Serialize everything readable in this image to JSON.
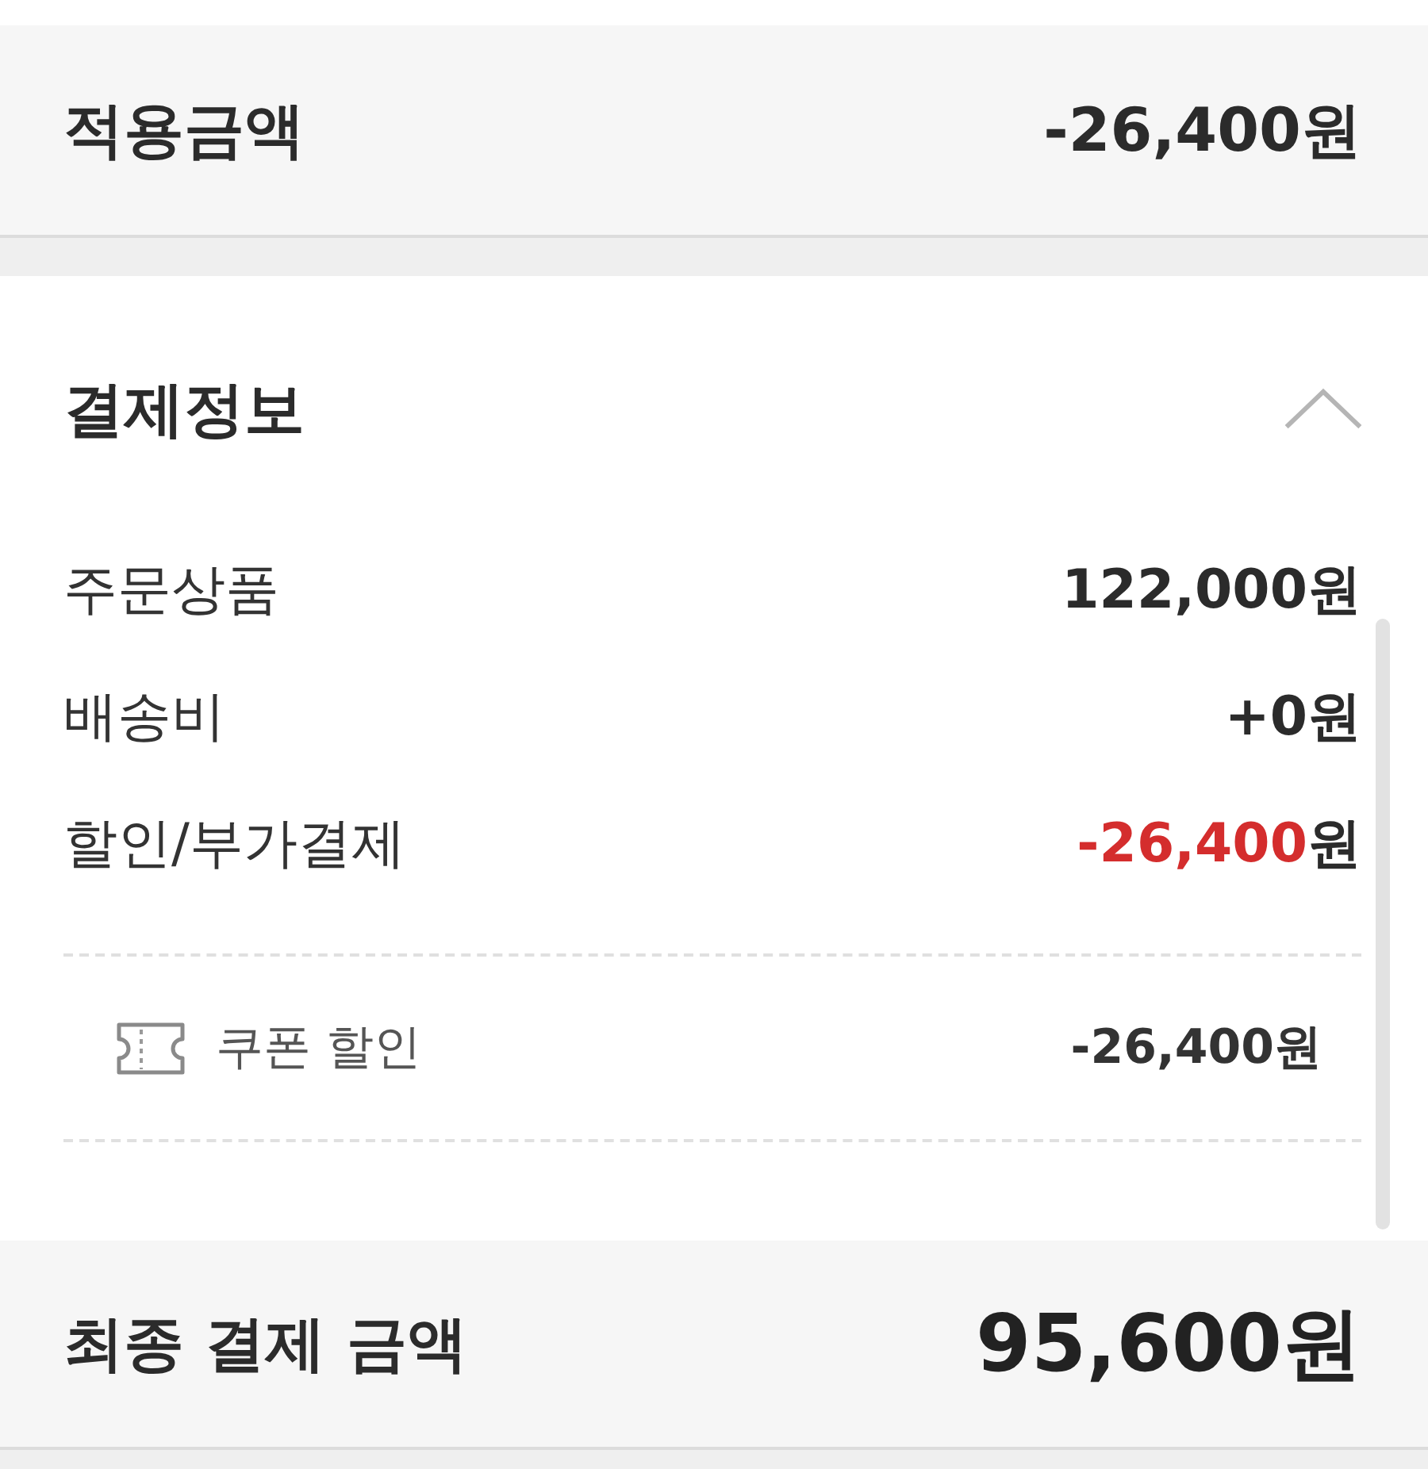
{
  "applied_amount": {
    "label": "적용금액",
    "value": "-26,400원"
  },
  "payment_info": {
    "title": "결제정보",
    "expanded": true,
    "rows": [
      {
        "label": "주문상품",
        "amount": "122,000",
        "unit": "원",
        "highlight": false
      },
      {
        "label": "배송비",
        "amount": "+0",
        "unit": "원",
        "highlight": false
      },
      {
        "label": "할인/부가결제",
        "amount": "-26,400",
        "unit": "원",
        "highlight": true
      }
    ],
    "details": [
      {
        "label": "쿠폰 할인",
        "value": "-26,400원"
      }
    ]
  },
  "total": {
    "label": "최종 결제 금액",
    "value": "95,600원"
  }
}
